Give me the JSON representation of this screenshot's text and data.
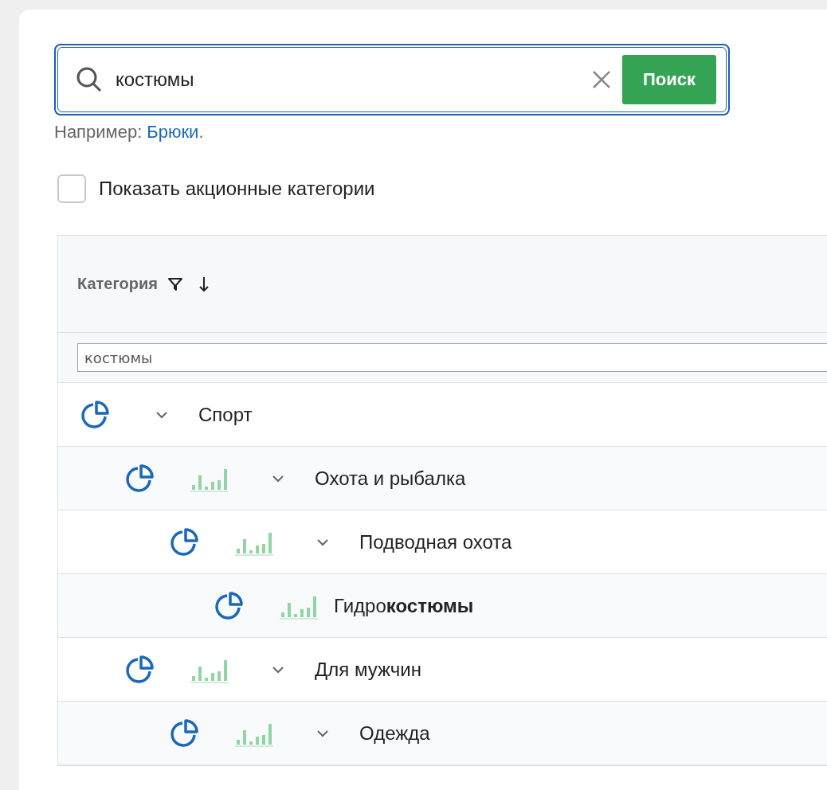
{
  "search": {
    "value": "костюмы",
    "button": "Поиск"
  },
  "hint": {
    "prefix": "Например:",
    "example": "Брюки",
    "suffix": "."
  },
  "promo_checkbox": {
    "label": "Показать акционные категории",
    "checked": false
  },
  "table": {
    "columns": [
      {
        "label": "Категория",
        "sorted_descending": true
      }
    ],
    "filter_value": "костюмы",
    "rows": [
      {
        "label": "Спорт",
        "chart": false,
        "expanded": true,
        "children": [
          {
            "label": "Охота и рыбалка",
            "chart": true,
            "expanded": true,
            "children": [
              {
                "label": "Подводная охота",
                "chart": true,
                "expanded": true,
                "children": [
                  {
                    "label": "Гидро**костюмы**",
                    "chart": true
                  }
                ]
              }
            ]
          },
          {
            "label": "Для мужчин",
            "chart": true,
            "expanded": true,
            "children": [
              {
                "label": "Одежда",
                "chart": true,
                "expanded": true
              }
            ]
          }
        ]
      }
    ]
  }
}
